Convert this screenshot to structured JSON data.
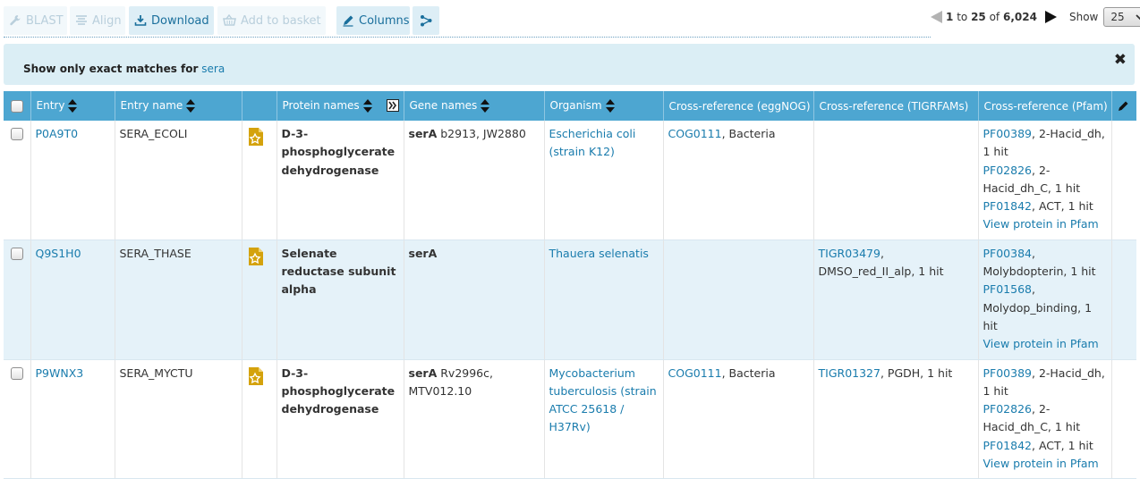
{
  "toolbar": {
    "blast": "BLAST",
    "align": "Align",
    "download": "Download",
    "basket": "Add to basket",
    "columns": "Columns"
  },
  "pager": {
    "from": "1",
    "to_word": "to",
    "to": "25",
    "of_word": "of",
    "total": "6,024",
    "show_label": "Show",
    "page_size": "25"
  },
  "message": {
    "prefix": "Show only exact matches for",
    "term": "sera"
  },
  "columns": [
    "Entry",
    "Entry name",
    "Protein names",
    "Gene names",
    "Organism",
    "Cross-reference (eggNOG)",
    "Cross-reference (TIGRFAMs)",
    "Cross-reference (Pfam)"
  ],
  "rows": [
    {
      "entry": "P0A9T0",
      "entry_name": "SERA_ECOLI",
      "protein": "D-3-phosphoglycerate dehydrogenase",
      "gene_main": "serA",
      "gene_other": " b2913, JW2880",
      "organism": "Escherichia coli (strain K12)",
      "eggnog_link": "COG0111",
      "eggnog_text": ", Bacteria",
      "tigr_link": "",
      "tigr_text": "",
      "pfam": [
        {
          "id": "PF00389",
          "desc": ", 2-Hacid_dh, 1 hit"
        },
        {
          "id": "PF02826",
          "desc": ", 2-Hacid_dh_C, 1 hit"
        },
        {
          "id": "PF01842",
          "desc": ", ACT, 1 hit"
        }
      ],
      "pfam_view": "View protein in Pfam"
    },
    {
      "entry": "Q9S1H0",
      "entry_name": "SERA_THASE",
      "protein": "Selenate reductase subunit alpha",
      "gene_main": "serA",
      "gene_other": "",
      "organism": "Thauera selenatis",
      "eggnog_link": "",
      "eggnog_text": "",
      "tigr_link": "TIGR03479",
      "tigr_text": ", DMSO_red_II_alp, 1 hit",
      "pfam": [
        {
          "id": "PF00384",
          "desc": ", Molybdopterin, 1 hit"
        },
        {
          "id": "PF01568",
          "desc": ", Molydop_binding, 1 hit"
        }
      ],
      "pfam_view": "View protein in Pfam"
    },
    {
      "entry": "P9WNX3",
      "entry_name": "SERA_MYCTU",
      "protein": "D-3-phosphoglycerate dehydrogenase",
      "gene_main": "serA",
      "gene_other": " Rv2996c, MTV012.10",
      "organism": "Mycobacterium tuberculosis (strain ATCC 25618 / H37Rv)",
      "eggnog_link": "COG0111",
      "eggnog_text": ", Bacteria",
      "tigr_link": "TIGR01327",
      "tigr_text": ", PGDH, 1 hit",
      "pfam": [
        {
          "id": "PF00389",
          "desc": ", 2-Hacid_dh, 1 hit"
        },
        {
          "id": "PF02826",
          "desc": ", 2-Hacid_dh_C, 1 hit"
        },
        {
          "id": "PF01842",
          "desc": ", ACT, 1 hit"
        }
      ],
      "pfam_view": "View protein in Pfam"
    }
  ],
  "colors": {
    "header_bg": "#4da6d1",
    "link": "#1a7cad",
    "alt_row": "#e5f2f9",
    "message_bg": "#dbeef5",
    "reviewed_icon": "#d4a20c"
  }
}
